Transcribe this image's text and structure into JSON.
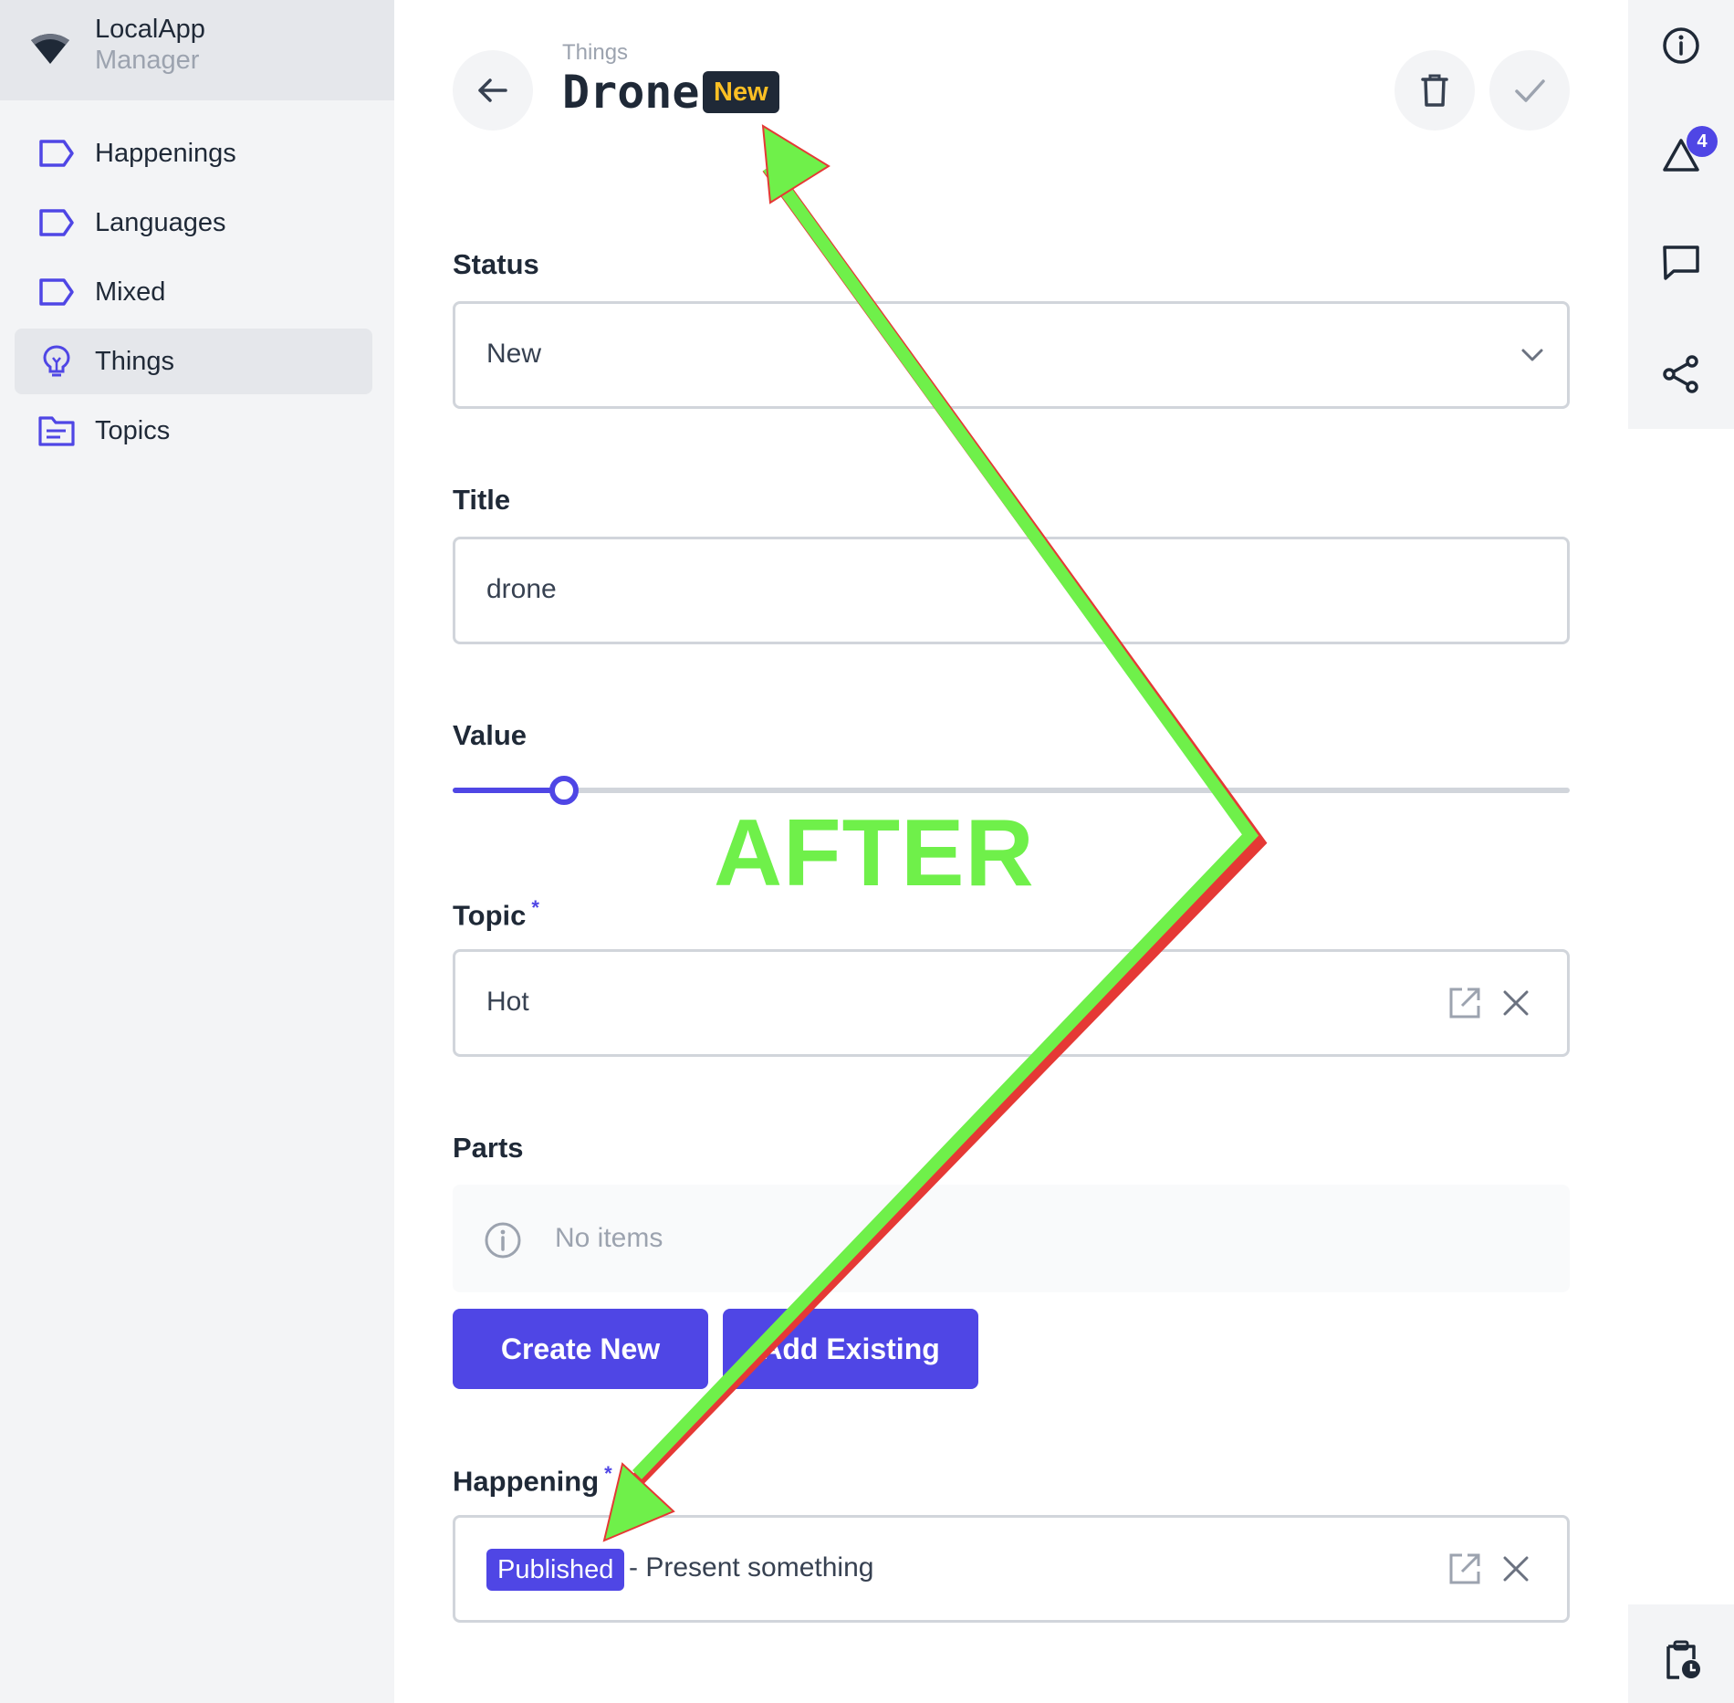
{
  "app": {
    "name": "LocalApp",
    "subtitle": "Manager"
  },
  "sidebar": {
    "items": [
      {
        "label": "Happenings",
        "icon": "tag-icon"
      },
      {
        "label": "Languages",
        "icon": "tag-icon"
      },
      {
        "label": "Mixed",
        "icon": "tag-icon"
      },
      {
        "label": "Things",
        "icon": "lightbulb-icon",
        "active": true
      },
      {
        "label": "Topics",
        "icon": "folder-icon"
      }
    ]
  },
  "header": {
    "breadcrumb": "Things",
    "title": "Drone",
    "status_badge": "New"
  },
  "form": {
    "status": {
      "label": "Status",
      "value": "New"
    },
    "title": {
      "label": "Title",
      "value": "drone"
    },
    "value": {
      "label": "Value",
      "level": 0.1
    },
    "topic": {
      "label": "Topic",
      "required_mark": "*",
      "value": "Hot"
    },
    "parts": {
      "label": "Parts",
      "empty_text": "No items",
      "create_label": "Create New",
      "add_label": "Add Existing"
    },
    "happening": {
      "label": "Happening",
      "required_mark": "*",
      "badge": "Published",
      "value": "- Present something"
    }
  },
  "rail": {
    "notification_count": "4"
  },
  "annotation": {
    "text": "AFTER"
  },
  "colors": {
    "accent": "#4f46e5",
    "annotation_green": "#6ff04a",
    "badge_text": "#fbbf24",
    "annotation_edge": "#e53935"
  }
}
